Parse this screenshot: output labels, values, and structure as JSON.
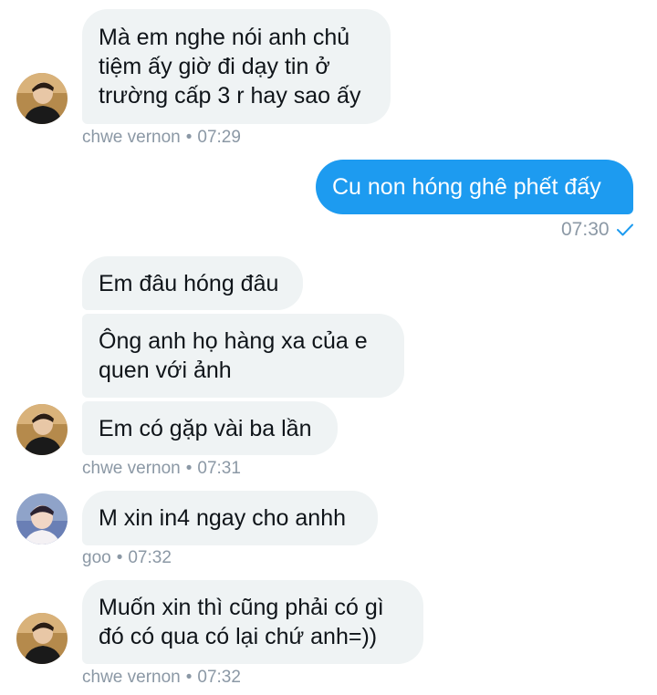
{
  "colors": {
    "incoming_bubble": "#eff3f4",
    "outgoing_bubble": "#1d9bf0",
    "meta_text": "#8b98a5",
    "read_check": "#1d9bf0"
  },
  "messages": [
    {
      "direction": "incoming",
      "sender": "chwe vernon",
      "lines": [
        "Mà em nghe nói anh chủ",
        "tiệm ấy giờ đi dạy tin ở",
        "trường cấp 3 r hay sao ấy"
      ],
      "meta": {
        "name": "chwe vernon",
        "sep": "•",
        "time": "07:29"
      }
    },
    {
      "direction": "outgoing",
      "text": "Cu non hóng ghê phết đấy",
      "meta": {
        "time": "07:30",
        "status_icon": "read-check-icon"
      }
    },
    {
      "direction": "incoming",
      "sender": "chwe vernon",
      "group": [
        {
          "lines": [
            "Em đâu hóng đâu"
          ]
        },
        {
          "lines": [
            "Ông anh họ hàng xa của e",
            "quen với ảnh"
          ]
        },
        {
          "lines": [
            "Em có gặp vài ba lần"
          ]
        }
      ],
      "meta": {
        "name": "chwe vernon",
        "sep": "•",
        "time": "07:31"
      }
    },
    {
      "direction": "incoming",
      "sender": "goo",
      "lines": [
        "M xin in4 ngay cho anhh"
      ],
      "meta": {
        "name": "goo",
        "sep": "•",
        "time": "07:32"
      }
    },
    {
      "direction": "incoming",
      "sender": "chwe vernon",
      "lines": [
        "Muốn xin thì cũng phải có gì",
        "đó có qua có lại chứ anh=))"
      ],
      "meta": {
        "name": "chwe vernon",
        "sep": "•",
        "time": "07:32"
      }
    }
  ]
}
